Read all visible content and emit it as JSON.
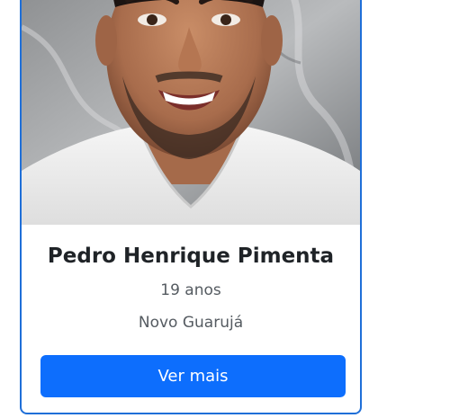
{
  "profile": {
    "name": "Pedro Henrique Pimenta",
    "age": "19 anos",
    "city": "Novo Guarujá",
    "photo_alt": "profile-photo"
  },
  "actions": {
    "more_label": "Ver mais"
  },
  "colors": {
    "card_border": "#1f6fd8",
    "button_bg": "#0d6efd",
    "button_text": "#ffffff",
    "name_text": "#1f2327",
    "meta_text": "#555b61"
  }
}
